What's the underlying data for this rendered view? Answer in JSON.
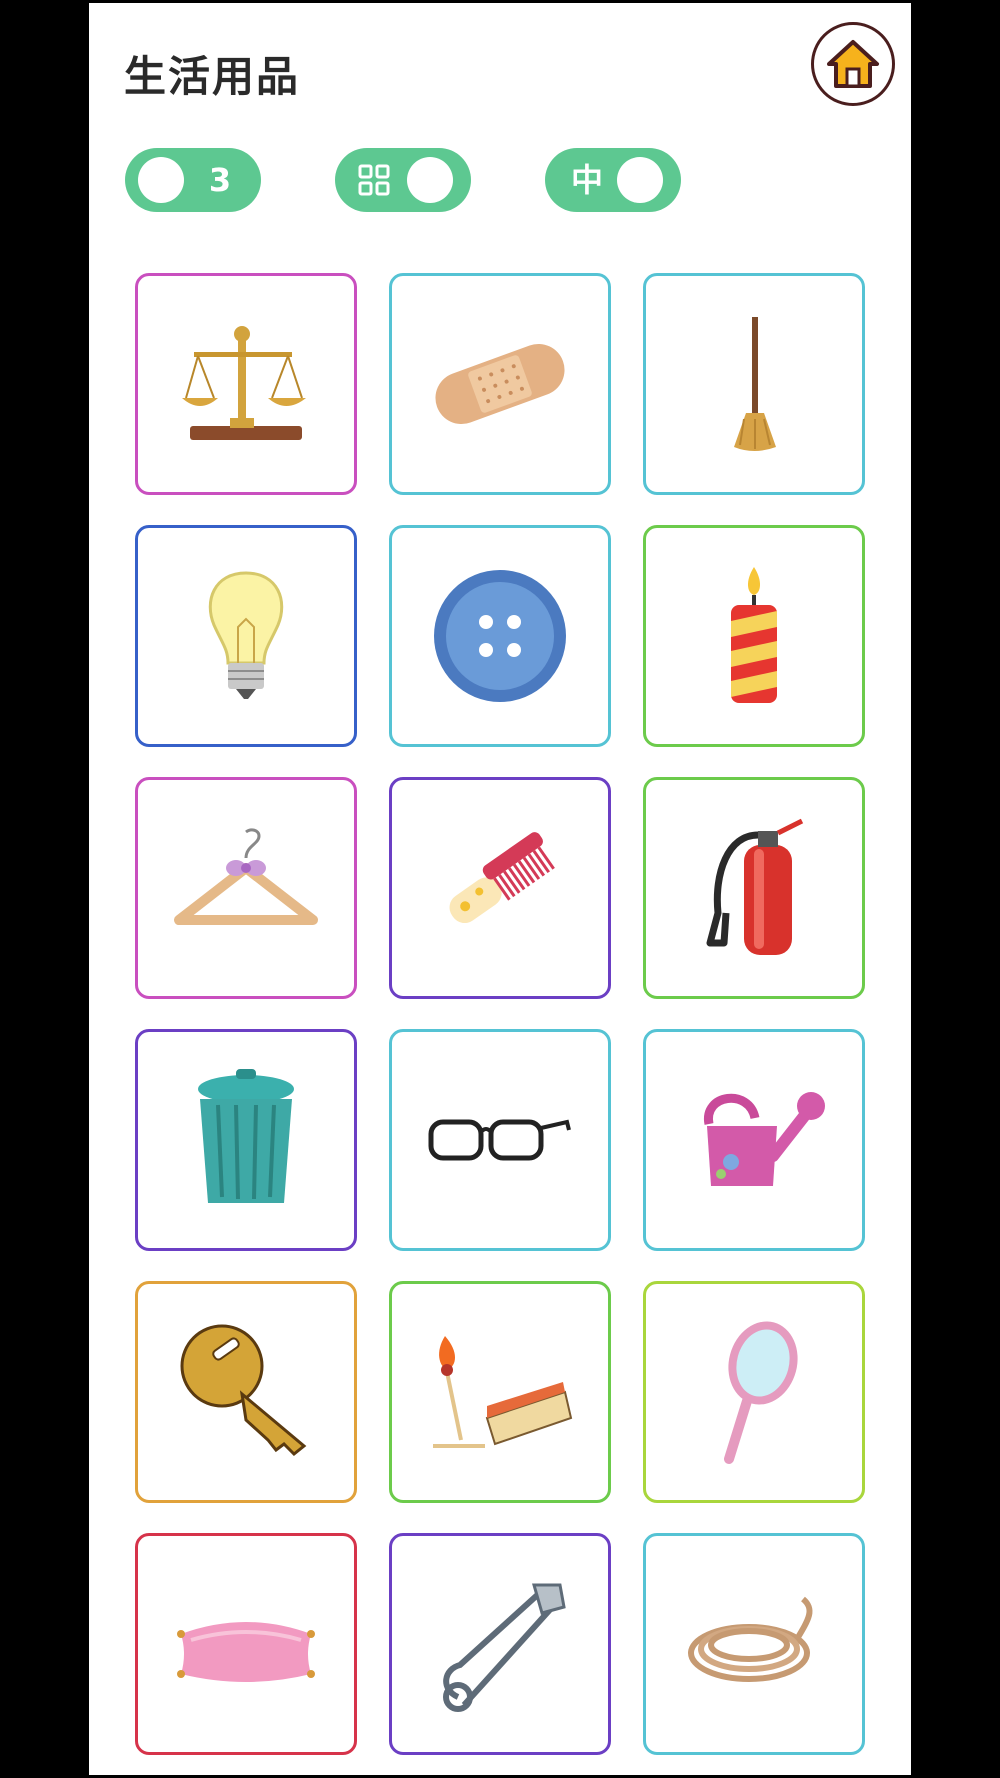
{
  "header": {
    "title": "生活用品"
  },
  "toggles": [
    {
      "name": "count-toggle",
      "label": "3"
    },
    {
      "name": "layout-toggle",
      "icon": "grid-icon"
    },
    {
      "name": "language-toggle",
      "label": "中"
    }
  ],
  "colors": {
    "toggle": "#5dc891",
    "home_border": "#4a1e1e",
    "home_fill": "#f6b21c"
  },
  "cards": [
    {
      "item": "balance-scale",
      "border": "#c94fbf"
    },
    {
      "item": "bandage",
      "border": "#55c3d4"
    },
    {
      "item": "broom",
      "border": "#55c3d4"
    },
    {
      "item": "light-bulb",
      "border": "#3660c9"
    },
    {
      "item": "button",
      "border": "#55c3d4"
    },
    {
      "item": "candle",
      "border": "#6ccb4b"
    },
    {
      "item": "hanger",
      "border": "#c94fbf"
    },
    {
      "item": "comb",
      "border": "#6b3fc4"
    },
    {
      "item": "fire-extinguisher",
      "border": "#6ccb4b"
    },
    {
      "item": "trash-can",
      "border": "#6b3fc4"
    },
    {
      "item": "glasses",
      "border": "#55c3d4"
    },
    {
      "item": "watering-can",
      "border": "#55c3d4"
    },
    {
      "item": "key",
      "border": "#e1a23b"
    },
    {
      "item": "matches",
      "border": "#6ccb4b"
    },
    {
      "item": "hand-mirror",
      "border": "#a9d63c"
    },
    {
      "item": "pillow",
      "border": "#d6334a"
    },
    {
      "item": "safety-pin",
      "border": "#6b3fc4"
    },
    {
      "item": "rope",
      "border": "#55c3d4"
    }
  ]
}
